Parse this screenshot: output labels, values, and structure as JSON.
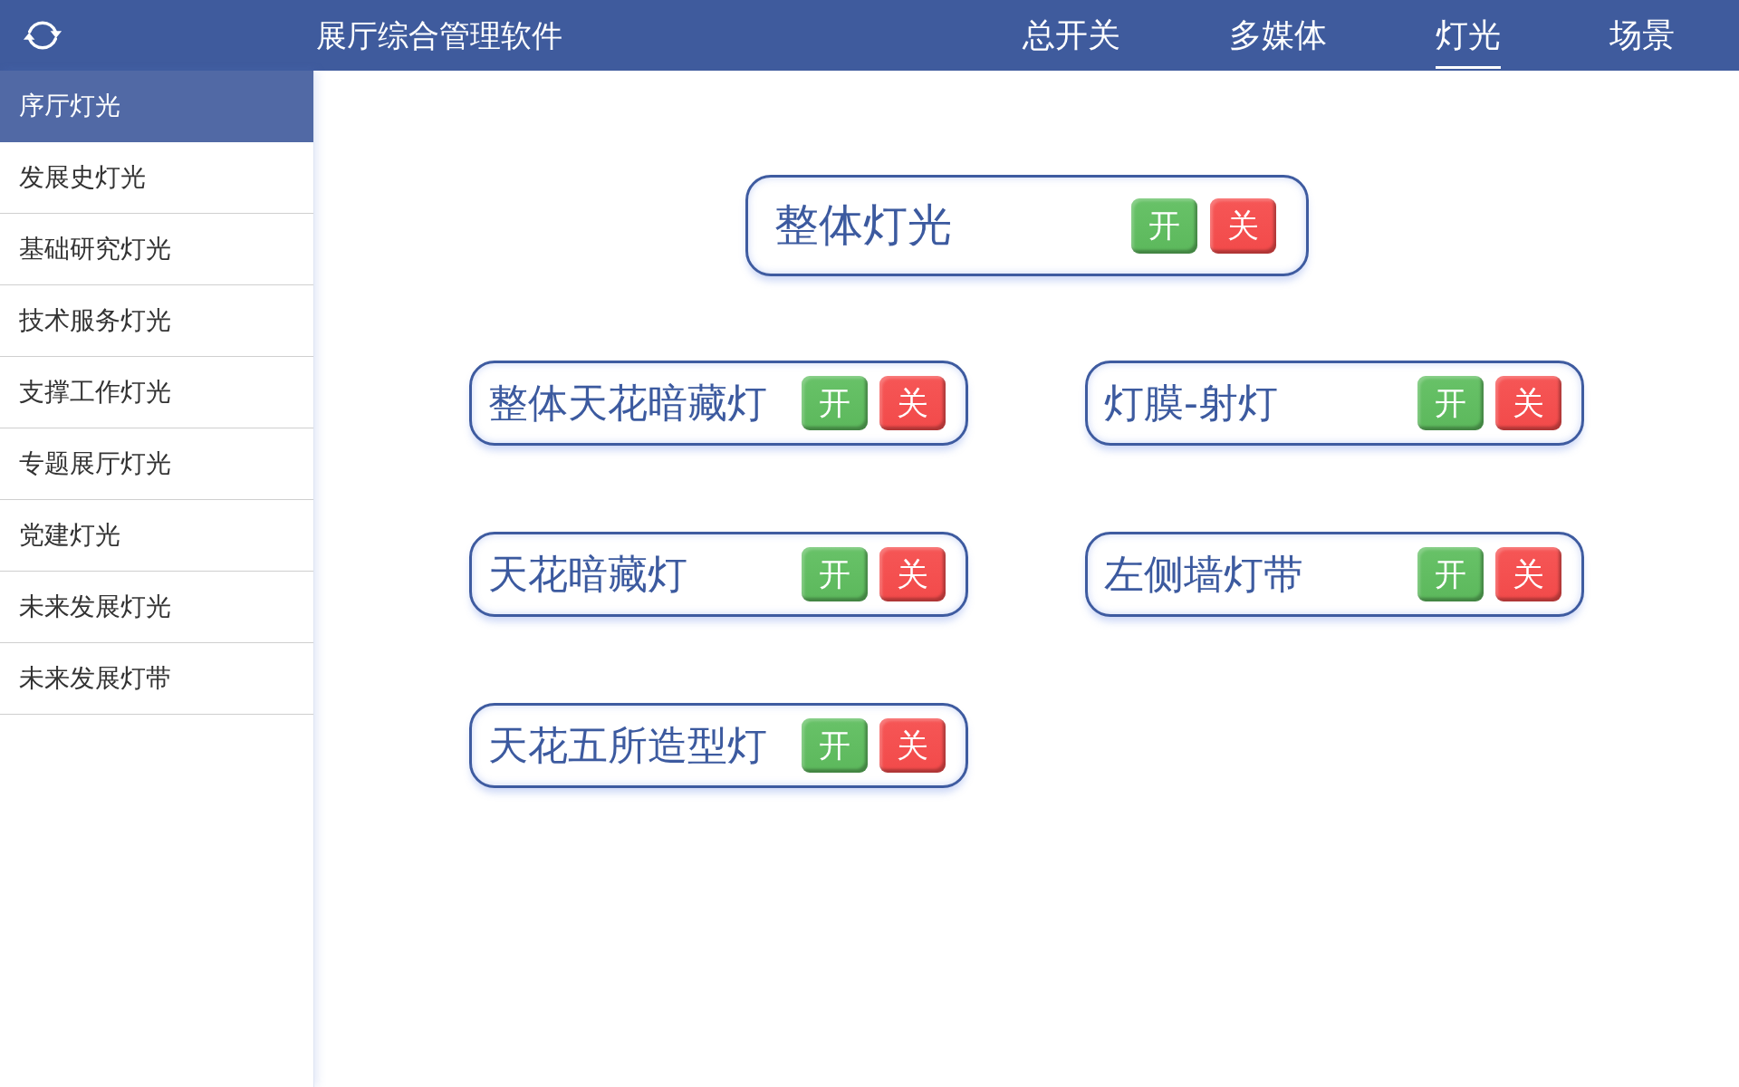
{
  "header": {
    "title": "展厅综合管理软件",
    "tabs": [
      {
        "label": "总开关",
        "selected": false
      },
      {
        "label": "多媒体",
        "selected": false
      },
      {
        "label": "灯光",
        "selected": true
      },
      {
        "label": "场景",
        "selected": false
      }
    ]
  },
  "sidebar": {
    "items": [
      {
        "label": "序厅灯光",
        "selected": true
      },
      {
        "label": "发展史灯光",
        "selected": false
      },
      {
        "label": "基础研究灯光",
        "selected": false
      },
      {
        "label": "技术服务灯光",
        "selected": false
      },
      {
        "label": "支撑工作灯光",
        "selected": false
      },
      {
        "label": "专题展厅灯光",
        "selected": false
      },
      {
        "label": "党建灯光",
        "selected": false
      },
      {
        "label": "未来发展灯光",
        "selected": false
      },
      {
        "label": "未来发展灯带",
        "selected": false
      }
    ]
  },
  "master_control": {
    "label": "整体灯光",
    "buttons": [
      {
        "label": "开",
        "kind": "on"
      },
      {
        "label": "关",
        "kind": "off"
      }
    ]
  },
  "controls": [
    {
      "label": "整体天花暗藏灯",
      "buttons": [
        {
          "label": "开",
          "kind": "on"
        },
        {
          "label": "关",
          "kind": "off"
        }
      ]
    },
    {
      "label": "灯膜-射灯",
      "buttons": [
        {
          "label": "开",
          "kind": "on"
        },
        {
          "label": "关",
          "kind": "off"
        }
      ]
    },
    {
      "label": "天花暗藏灯",
      "buttons": [
        {
          "label": "开",
          "kind": "on"
        },
        {
          "label": "关",
          "kind": "off"
        }
      ]
    },
    {
      "label": "左侧墙灯带",
      "buttons": [
        {
          "label": "开",
          "kind": "on"
        },
        {
          "label": "关",
          "kind": "off"
        }
      ]
    },
    {
      "label": "天花五所造型灯",
      "buttons": [
        {
          "label": "开",
          "kind": "on"
        },
        {
          "label": "关",
          "kind": "off"
        }
      ]
    }
  ]
}
